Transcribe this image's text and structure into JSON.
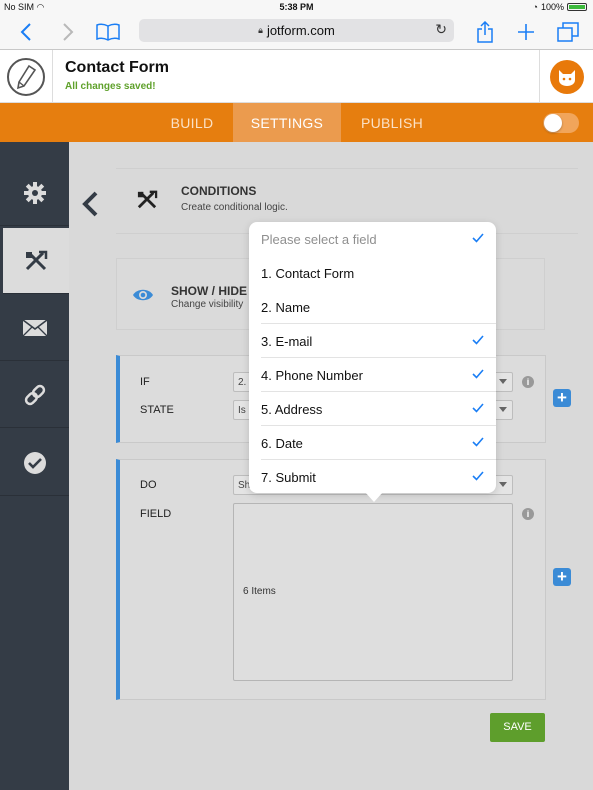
{
  "status_bar": {
    "carrier": "No SIM",
    "time": "5:38 PM",
    "battery": "100%"
  },
  "browser": {
    "url": "jotform.com"
  },
  "app": {
    "title": "Contact Form",
    "save_status": "All changes saved!"
  },
  "tabs": [
    {
      "label": "BUILD",
      "active": false
    },
    {
      "label": "SETTINGS",
      "active": true
    },
    {
      "label": "PUBLISH",
      "active": false
    }
  ],
  "sidebar": {
    "items": [
      {
        "icon": "gear-icon",
        "active": false
      },
      {
        "icon": "conditions-icon",
        "active": true
      },
      {
        "icon": "envelope-icon",
        "active": false
      },
      {
        "icon": "link-icon",
        "active": false
      },
      {
        "icon": "checkmark-icon",
        "active": false
      }
    ]
  },
  "conditions": {
    "title": "CONDITIONS",
    "subtitle": "Create conditional logic."
  },
  "show_hide": {
    "title": "SHOW / HIDE",
    "subtitle": "Change visibility"
  },
  "if_panel": {
    "if_label": "IF",
    "if_value": "2.",
    "state_label": "STATE",
    "state_value": "Is"
  },
  "do_panel": {
    "do_label": "DO",
    "do_value": "Sh",
    "field_label": "FIELD",
    "items_count": "6 Items"
  },
  "save_label": "SAVE",
  "picker": {
    "placeholder": "Please select a field",
    "placeholder_checked": true,
    "options": [
      {
        "label": "1. Contact Form",
        "checked": false
      },
      {
        "label": "2. Name",
        "checked": false
      },
      {
        "label": "3. E-mail",
        "checked": true
      },
      {
        "label": "4. Phone Number",
        "checked": true
      },
      {
        "label": "5. Address",
        "checked": true
      },
      {
        "label": "6. Date",
        "checked": true
      },
      {
        "label": "7. Submit",
        "checked": true
      }
    ]
  },
  "colors": {
    "accent_orange": "#e67e0f",
    "accent_blue": "#3b8bd6",
    "ios_blue": "#1a7ef5",
    "save_green": "#5e9e2c",
    "sidebar": "#343c46"
  }
}
